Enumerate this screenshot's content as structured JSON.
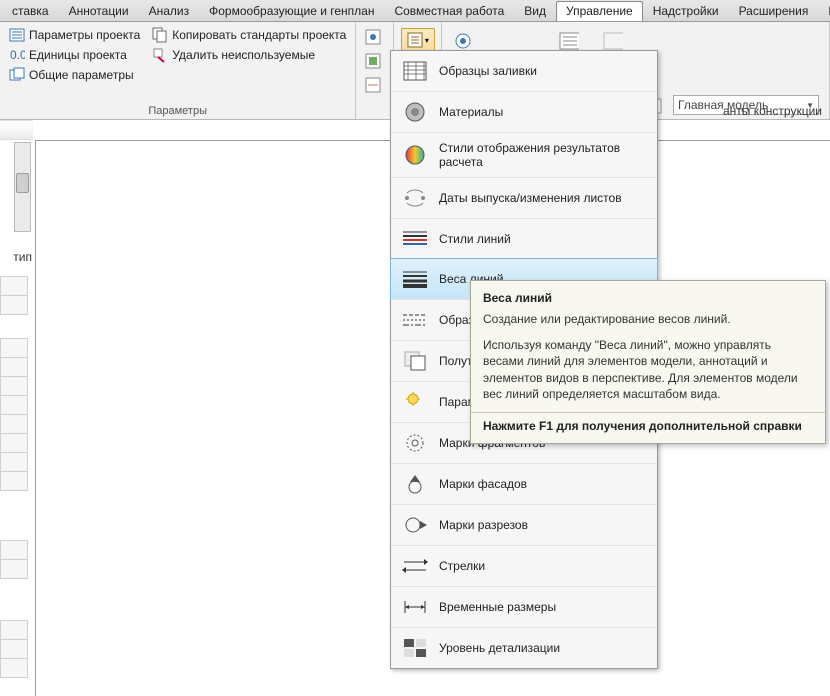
{
  "menubar": {
    "items": [
      "ставка",
      "Аннотации",
      "Анализ",
      "Формообразующие и генплан",
      "Совместная работа",
      "Вид",
      "Управление",
      "Надстройки",
      "Расширения",
      "И"
    ],
    "active_index": 6
  },
  "ribbon": {
    "panel1": {
      "btn_params_project": "Параметры проекта",
      "btn_units_project": "Единицы проекта",
      "btn_shared_params": "Общие параметры",
      "btn_copy_standards": "Копировать стандарты проекта",
      "btn_purge": "Удалить неиспользуемые",
      "title": "Параметры"
    },
    "view_selector": {
      "value": "Главная модель"
    },
    "sub_caption": "анты конструкции"
  },
  "left_label": "тип",
  "dropdown": {
    "items": [
      "Образцы заливки",
      "Материалы",
      "Стили отображения результатов расчета",
      "Даты выпуска/изменения листов",
      "Стили линий",
      "Веса линий",
      "Образцы",
      "Полутона",
      "Параметры",
      "Марки фрагментов",
      "Марки фасадов",
      "Марки разрезов",
      "Стрелки",
      "Временные размеры",
      "Уровень детализации"
    ],
    "hover_index": 5
  },
  "tooltip": {
    "title": "Веса линий",
    "line1": "Создание или редактирование весов линий.",
    "body": "Используя команду \"Веса линий\", можно управлять весами линий для элементов модели, аннотаций и элементов видов в перспективе. Для элементов модели вес линий определяется масштабом вида.",
    "hint": "Нажмите F1 для получения дополнительной справки"
  }
}
